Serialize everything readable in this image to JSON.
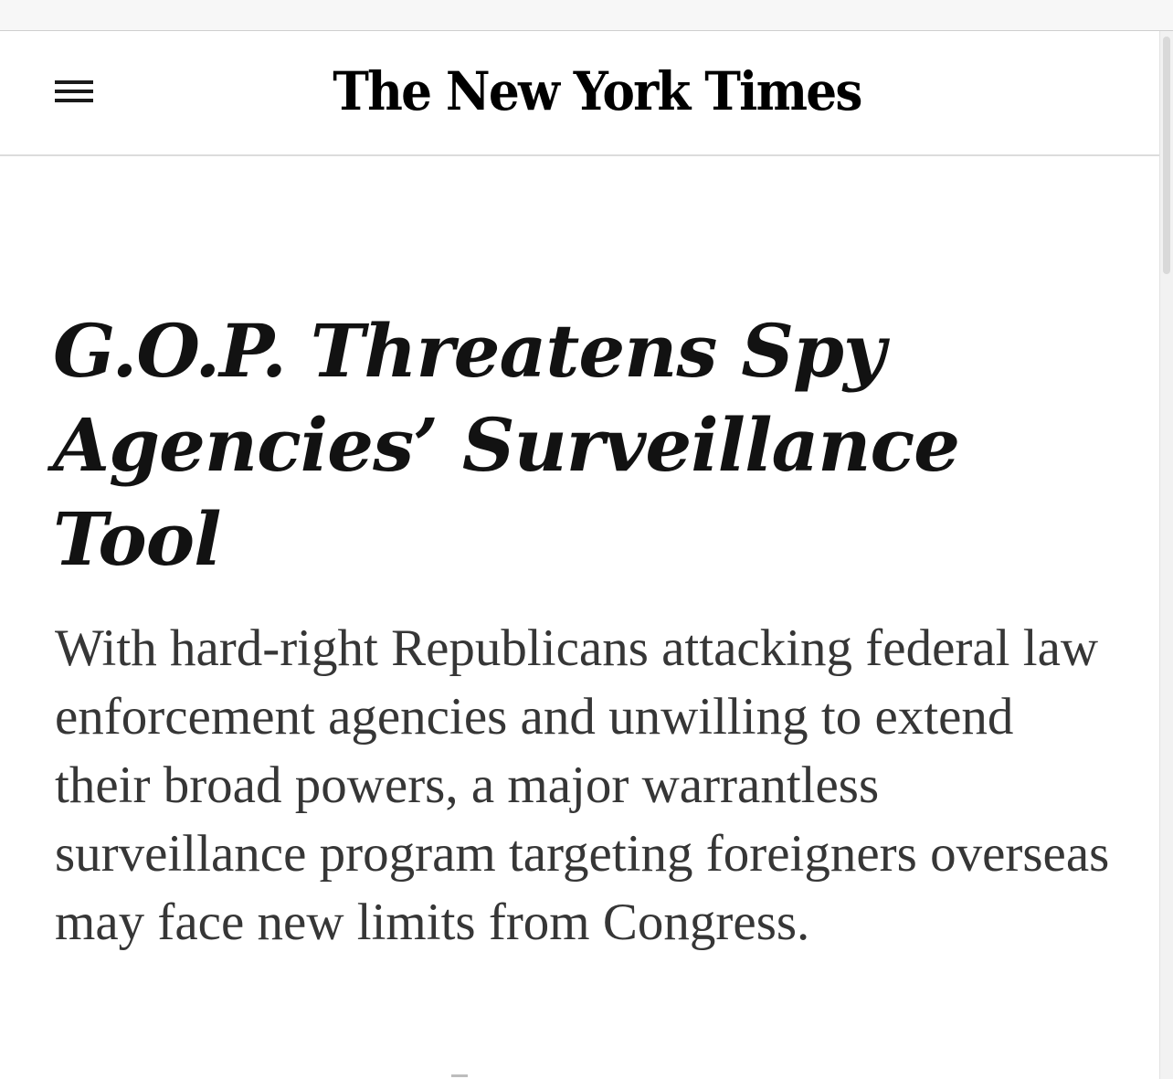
{
  "header": {
    "logo_text": "The New York Times",
    "menu_icon": "hamburger-menu-icon"
  },
  "article": {
    "headline": "G.O.P. Threatens Spy Agencies’ Surveillance Tool",
    "summary": "With hard-right Republicans attacking federal law enforcement agencies and unwilling to extend their broad powers, a major warrantless surveillance program targeting foreigners overseas may face new limits from Congress."
  },
  "colors": {
    "headline_text": "#121212",
    "summary_text": "#363636",
    "background": "#ffffff",
    "masthead_border": "#dcdcdc"
  }
}
